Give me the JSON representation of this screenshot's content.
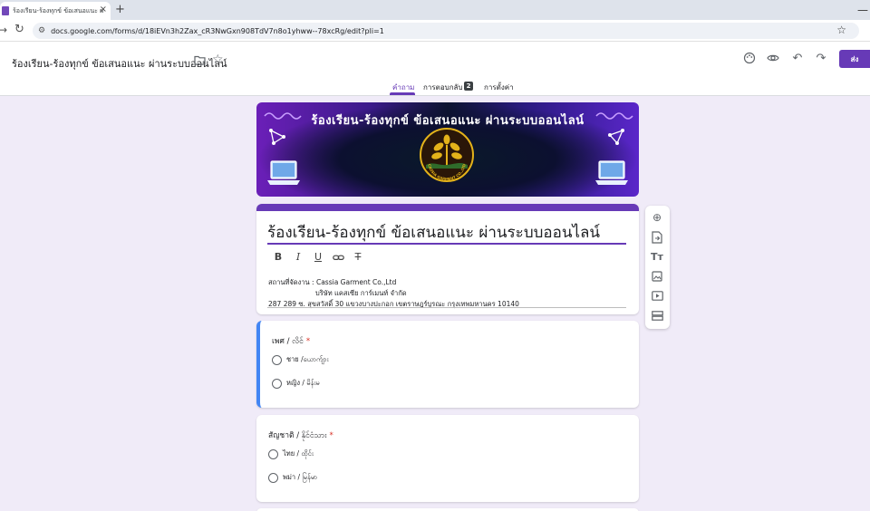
{
  "browser": {
    "tab_title": "ร้องเรียน-ร้องทุกข์ ข้อเสนอแนะ ผ่านระบบ",
    "tab_close": "×",
    "new_tab": "+",
    "url": "docs.google.com/forms/d/18iEVn3h2Zax_cR3NwGxn908TdV7n8o1yhww--78xcRg/edit?pli=1"
  },
  "header": {
    "doc_title": "ร้องเรียน-ร้องทุกข์ ข้อเสนอแนะ ผ่านระบบออนไลน์",
    "send_label": "ส่ง",
    "tabs": [
      {
        "label": "คำถาม",
        "active": true
      },
      {
        "label": "การตอบกลับ",
        "badge": "2"
      },
      {
        "label": "การตั้งค่า"
      }
    ]
  },
  "banner": {
    "title": "ร้องเรียน-ร้องทุกข์ ข้อเสนอแนะ ผ่านระบบออนไลน์",
    "logo_text": "CASSIA GARMENT CO.,LTD"
  },
  "form": {
    "title": "ร้องเรียน-ร้องทุกข์ ข้อเสนอแนะ ผ่านระบบออนไลน์",
    "description_lines": [
      "สถานที่จัดงาน : Cassia Garment Co.,Ltd",
      "บริษัท แคสเซีย การ์เมนท์ จำกัด",
      "287 289 ซ. สุขสวัสดิ์ 30 แขวงบางปะกอก เขตราษฎร์บูรณะ กรุงเทพมหานคร 10140"
    ]
  },
  "questions": [
    {
      "title": "เพศ / လိင်",
      "required_mark": "*",
      "options": [
        "ชาย /ယောက်ျား",
        "หญิง / မိန်းမ"
      ]
    },
    {
      "title": "สัญชาติ / နိုင်ငံသား",
      "required_mark": "*",
      "options": [
        "ไทย / ထိုင်း",
        "พม่า / မြန်မာ"
      ]
    }
  ],
  "colors": {
    "accent": "#673ab7",
    "background": "#f0ebf8",
    "active_question": "#4285f4",
    "required": "#d93025"
  }
}
